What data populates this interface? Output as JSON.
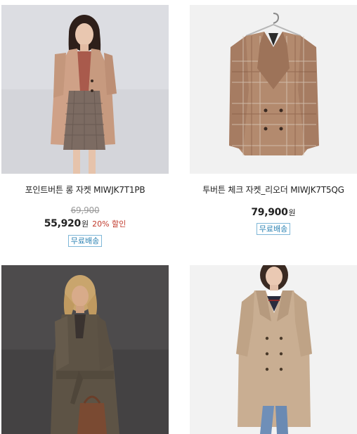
{
  "products": [
    {
      "name": "포인트버튼 롱 자켓 MIWJK7T1PB",
      "original_price": "69,900",
      "price": "55,920",
      "currency": "원",
      "discount": "20% 할인",
      "badge": "무료배송"
    },
    {
      "name": "투버튼 체크 자켓_리오더 MIWJK7T5QG",
      "price": "79,900",
      "currency": "원",
      "badge": "무료배송"
    },
    {
      "name": "",
      "price": "",
      "badge": ""
    },
    {
      "name": "",
      "price": "",
      "badge": ""
    }
  ]
}
